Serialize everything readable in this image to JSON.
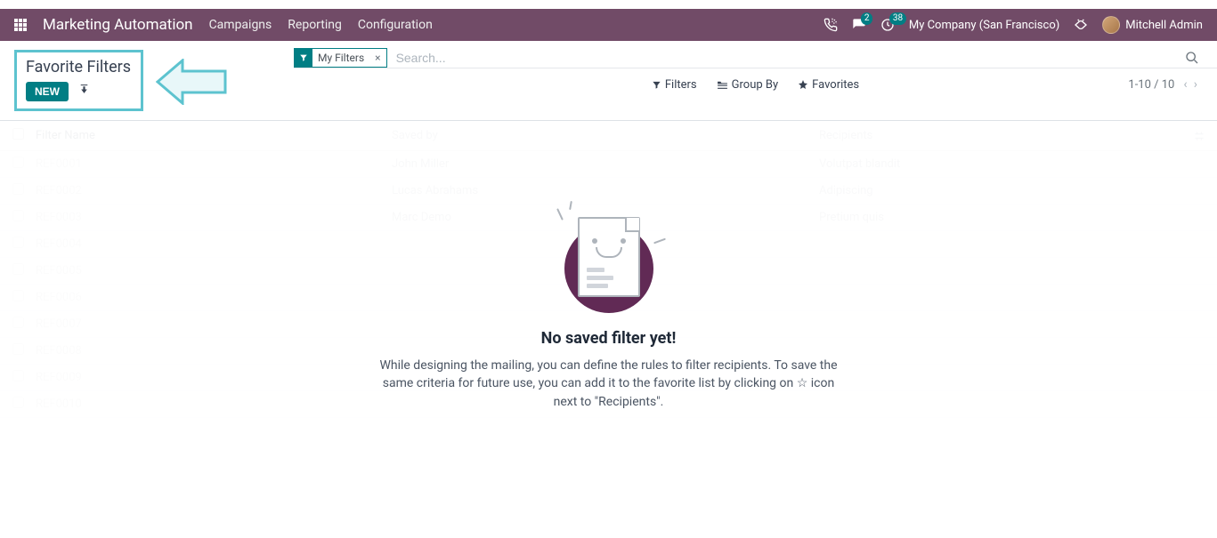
{
  "header": {
    "brand": "Marketing Automation",
    "menu": [
      "Campaigns",
      "Reporting",
      "Configuration"
    ],
    "chat_badge": "2",
    "activity_badge": "38",
    "company": "My Company (San Francisco)",
    "user": "Mitchell Admin"
  },
  "breadcrumb": {
    "title": "Favorite Filters",
    "new_label": "NEW"
  },
  "search": {
    "facet_label": "My Filters",
    "placeholder": "Search..."
  },
  "toolbar": {
    "filters": "Filters",
    "groupby": "Group By",
    "favorites": "Favorites"
  },
  "pager": {
    "text": "1-10 / 10"
  },
  "columns": {
    "name": "Filter Name",
    "saved_by": "Saved by",
    "recipients": "Recipients"
  },
  "rows": [
    {
      "name": "REF0001",
      "saved": "John Miller",
      "rec": "Volutpat blandit"
    },
    {
      "name": "REF0002",
      "saved": "Lucas Abrahams",
      "rec": "Adipiscing"
    },
    {
      "name": "REF0003",
      "saved": "Marc Demo",
      "rec": "Pretium quis"
    },
    {
      "name": "REF0004",
      "saved": "",
      "rec": ""
    },
    {
      "name": "REF0005",
      "saved": "",
      "rec": ""
    },
    {
      "name": "REF0006",
      "saved": "",
      "rec": ""
    },
    {
      "name": "REF0007",
      "saved": "",
      "rec": ""
    },
    {
      "name": "REF0008",
      "saved": "",
      "rec": ""
    },
    {
      "name": "REF0009",
      "saved": "",
      "rec": ""
    },
    {
      "name": "REF0010",
      "saved": "",
      "rec": ""
    }
  ],
  "empty": {
    "title": "No saved filter yet!",
    "text1": "While designing the mailing, you can define the rules to filter recipients. To save the same criteria for future use, you can add it to the favorite list by clicking on ",
    "text2": " icon next to \"Recipients\"."
  }
}
